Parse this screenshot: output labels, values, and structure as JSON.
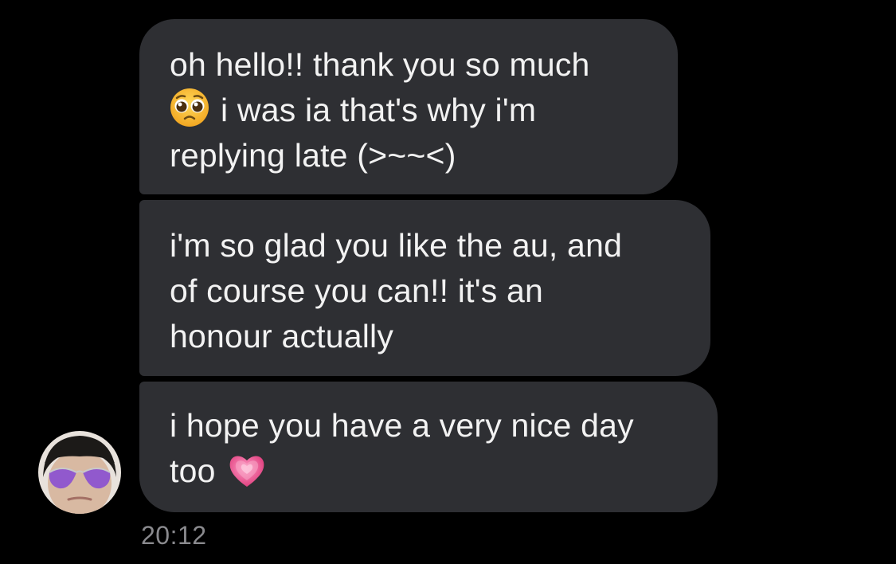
{
  "messages": [
    {
      "lines": [
        "oh hello!! thank you so much",
        "i was ia that's why i'm",
        "replying late (>~~<)"
      ],
      "emoji": "pleading-face-icon"
    },
    {
      "lines": [
        "i'm so glad you like the au, and",
        "of course you can!! it's an",
        "honour actually"
      ]
    },
    {
      "lines": [
        "i hope you have a very nice day",
        "too"
      ],
      "emoji": "growing-heart-icon"
    }
  ],
  "timestamp": "20:12",
  "colors": {
    "background": "#000000",
    "bubble": "#2e2f33",
    "text": "#f2f2f2",
    "timestamp": "#8a8a8e",
    "heart": "#ee5a9b"
  }
}
